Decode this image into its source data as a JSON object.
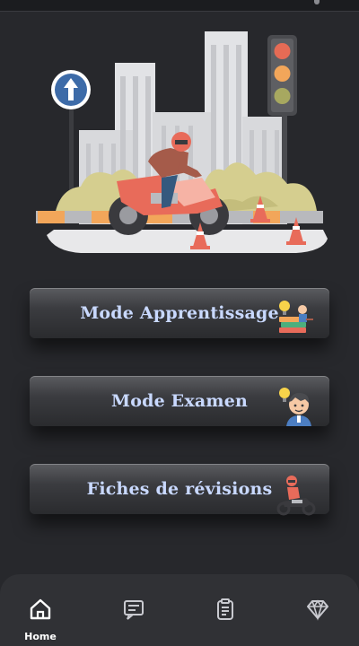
{
  "menu": {
    "items": [
      {
        "label": "Mode Apprentissage",
        "icon": "books-lightbulb-icon"
      },
      {
        "label": "Mode Examen",
        "icon": "student-lightbulb-icon"
      },
      {
        "label": "Fiches de révisions",
        "icon": "motorcyclist-icon"
      }
    ]
  },
  "bottom_nav": {
    "items": [
      {
        "label": "Home",
        "icon": "home-icon",
        "active": true
      },
      {
        "label": "",
        "icon": "chat-icon"
      },
      {
        "label": "",
        "icon": "clipboard-icon"
      },
      {
        "label": "",
        "icon": "diamond-icon"
      }
    ]
  },
  "colors": {
    "background": "#27282c",
    "button_text": "#c9d9ff",
    "nav_background": "#303135",
    "nav_icon": "#c9cad0"
  }
}
